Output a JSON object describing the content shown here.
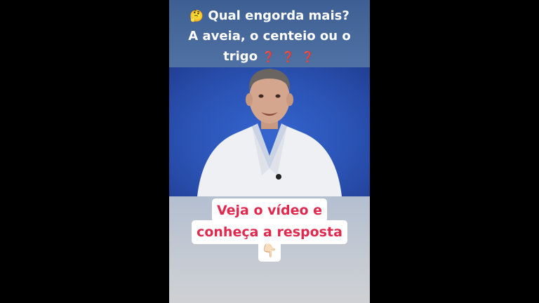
{
  "headline": {
    "emoji": "🤔",
    "line1": "Qual engorda mais?",
    "line2": "A aveia, o centeio ou o",
    "line3": "trigo",
    "qmarks": "❓ ❓ ❓"
  },
  "callout": {
    "line1": "Veja o vídeo e",
    "line2": "conheça a resposta",
    "pointer_emoji": "👇🏻"
  },
  "colors": {
    "background": "#000000",
    "backdrop_blue": "#2f5bbd",
    "callout_text": "#e2284d",
    "qmark_red": "#d8232a"
  }
}
